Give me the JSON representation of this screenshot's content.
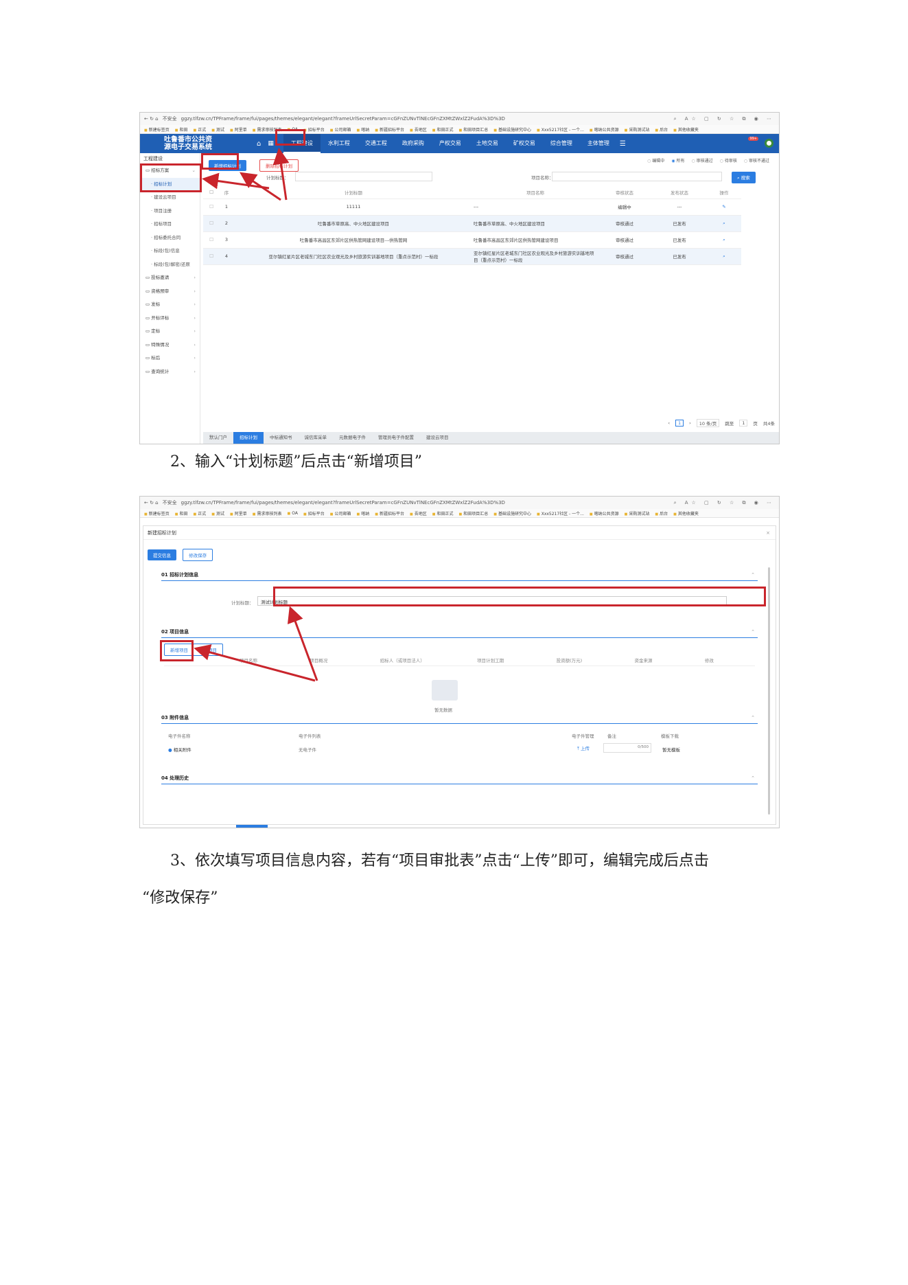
{
  "browser": {
    "security": "不安全",
    "url": "ggzy.tlfzw.cn/TPFrame/frame/fui/pages/themes/elegant/elegant?frameUrlSecretParam=cGFnZUNvTlNEcGFnZXMtZWxlZ2FudA%3D%3D",
    "bookmarks": [
      "新建标签页",
      "和田",
      "正式",
      "测试",
      "阿里单",
      "需求审核列表",
      "OA",
      "招标平台",
      "公司邮箱",
      "喀纳",
      "新疆招标平台",
      "吾地区",
      "和田正式",
      "和田项目汇总",
      "基础设施研究中心",
      "Xxx5217社区 - 一个...",
      "喀纳公共资源",
      "采购测试站",
      "后台",
      "其他收藏夹"
    ]
  },
  "app": {
    "logo_line1": "吐鲁番市公共资",
    "logo_line2": "源电子交易系统",
    "nav": [
      "工程建设",
      "水利工程",
      "交通工程",
      "政府采购",
      "产权交易",
      "土地交易",
      "矿权交易",
      "综合管理",
      "主体管理"
    ],
    "badge": "99+",
    "sidebar_title": "工程建设",
    "sidebar": [
      {
        "label": "招标方案",
        "type": "group"
      },
      {
        "label": "招标计划",
        "type": "sub"
      },
      {
        "label": "建设云项目",
        "type": "sub"
      },
      {
        "label": "项目注册",
        "type": "sub"
      },
      {
        "label": "招标项目",
        "type": "sub"
      },
      {
        "label": "招标委托合同",
        "type": "sub"
      },
      {
        "label": "标段(包)信息",
        "type": "sub"
      },
      {
        "label": "标段(包)解密/还原",
        "type": "sub"
      },
      {
        "label": "投标邀请",
        "type": "group"
      },
      {
        "label": "资格预审",
        "type": "group"
      },
      {
        "label": "发标",
        "type": "group"
      },
      {
        "label": "开标评标",
        "type": "group"
      },
      {
        "label": "定标",
        "type": "group"
      },
      {
        "label": "特殊情况",
        "type": "group"
      },
      {
        "label": "标后",
        "type": "group"
      },
      {
        "label": "查询统计",
        "type": "group"
      }
    ],
    "buttons": {
      "add_plan": "新增招标计划",
      "delete_plan": "删除招标计划",
      "search": "搜索"
    },
    "radios": [
      "编辑中",
      "所有",
      "审核通过",
      "待审核",
      "审核不通过"
    ],
    "filter": {
      "plan_label": "计划标题：",
      "project_label": "项目名称："
    },
    "table_headers": [
      "序",
      "计划标题",
      "项目名称",
      "审核状态",
      "发布状态",
      "操作"
    ],
    "rows": [
      {
        "no": "1",
        "title": "11111",
        "project": "---",
        "audit": "编辑中",
        "publish": "---"
      },
      {
        "no": "2",
        "title": "吐鲁番市草原高、中火地区建设项目",
        "project": "吐鲁番市草原高、中火地区建设项目",
        "audit": "审核通过",
        "publish": "已发布"
      },
      {
        "no": "3",
        "title": "吐鲁番市高昌区东郊片区供热管网建设项目---供热管网",
        "project": "吐鲁番市高昌区东郊片区供热管网建设项目",
        "audit": "审核通过",
        "publish": "已发布"
      },
      {
        "no": "4",
        "title": "亚尔镇红星片区老城东门社区农业观光及乡村旅游实训基地项目（重点示范村）一标段",
        "project": "亚尔镇红星片区老城东门社区农业观光及乡村旅游实训基地项目（重点示范村）一标段",
        "audit": "审核通过",
        "publish": "已发布"
      }
    ],
    "pager": {
      "page": "1",
      "per_page": "10 条/页",
      "goto_label": "跳至",
      "goto_value": "1",
      "page_unit": "页",
      "total": "共4条"
    },
    "tabs": [
      "默认门户",
      "招标计划",
      "中标通知书",
      "诚信库采单",
      "元数据电子件",
      "管理员电子件配置",
      "建设云项目"
    ]
  },
  "caption2": "2、输入“计划标题”后点击“新增项目”",
  "modal": {
    "title": "新建招标计划",
    "submit": "提交信息",
    "save": "修改保存",
    "sec1": "01 招标计划信息",
    "plan_label": "计划标题：",
    "plan_value": "测试计划标题",
    "sec2": "02 项目信息",
    "add_project": "新增项目",
    "delete_project": "删除项目",
    "proj_headers": [
      "项目名称",
      "项目概况",
      "招标人（或项目法人）",
      "项目计划工期",
      "投资额(万元)",
      "资金来源",
      "修改"
    ],
    "empty": "暂无数据",
    "sec3": "03 附件信息",
    "att_headers": [
      "电子件名称",
      "电子件列表",
      "电子件管理",
      "备注",
      "模板下载"
    ],
    "att_name": "相关附件",
    "att_list": "无电子件",
    "upload": "上传",
    "remark_count": "0/500",
    "template": "暂无模板",
    "sec4": "04 处理历史"
  },
  "caption3_line1": "3、依次填写项目信息内容，若有“项目审批表”点击“上传”即可，编辑完成后点击",
  "caption3_line2": "“修改保存”"
}
